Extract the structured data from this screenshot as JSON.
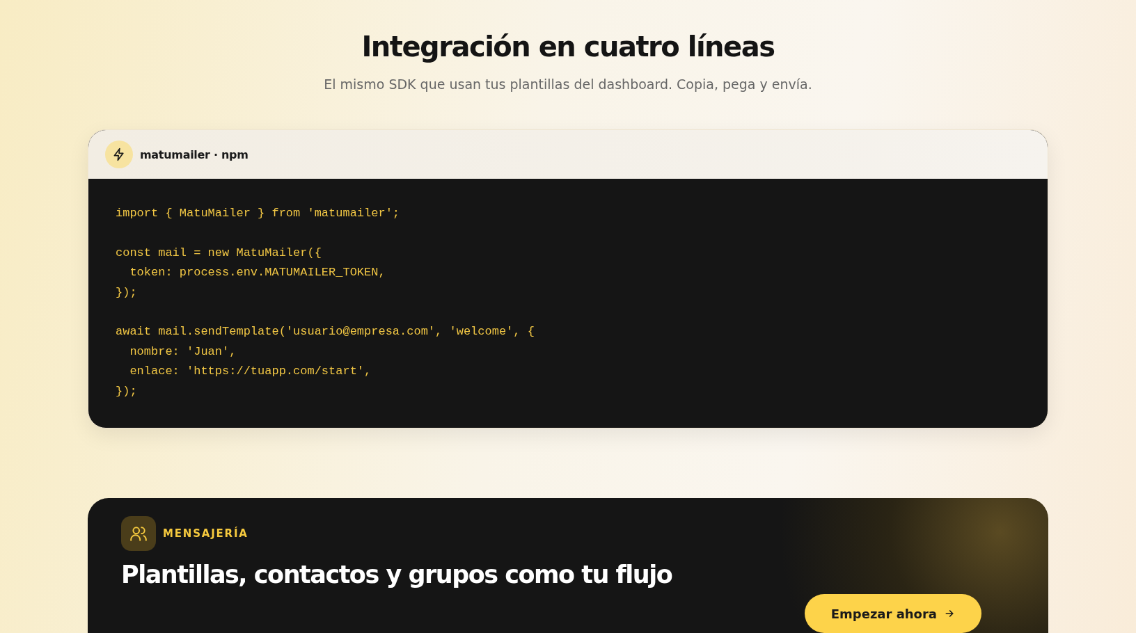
{
  "section": {
    "title": "Integración en cuatro líneas",
    "subtitle": "El mismo SDK que usan tus plantillas del dashboard. Copia, pega y envía."
  },
  "code_card": {
    "header": "matumailer · npm",
    "code_groups": [
      [
        "import { MatuMailer } from 'matumailer';"
      ],
      [
        "const mail = new MatuMailer({",
        "  token: process.env.MATUMAILER_TOKEN,",
        "});"
      ],
      [
        "await mail.sendTemplate('usuario@empresa.com', 'welcome', {",
        "  nombre: 'Juan',",
        "  enlace: 'https://tuapp.com/start',",
        "});"
      ]
    ]
  },
  "feature": {
    "eyebrow": "MENSAJERÍA",
    "title": "Plantillas, contactos y grupos como tu flujo",
    "button": "Empezar ahora"
  }
}
